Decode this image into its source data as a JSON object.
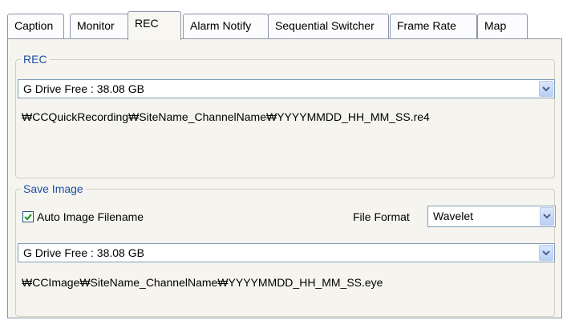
{
  "tabs": [
    {
      "label": "Caption",
      "active": false
    },
    {
      "label": "Monitor",
      "active": false
    },
    {
      "label": "REC",
      "active": true
    },
    {
      "label": "Alarm Notify",
      "active": false
    },
    {
      "label": "Sequential Switcher",
      "active": false
    },
    {
      "label": "Frame Rate",
      "active": false
    },
    {
      "label": "Map",
      "active": false
    }
  ],
  "rec": {
    "title": "REC",
    "drive": "G Drive  Free : 38.08 GB",
    "path": "₩CCQuickRecording₩SiteName_ChannelName₩YYYYMMDD_HH_MM_SS.re4"
  },
  "save_image": {
    "title": "Save Image",
    "auto_filename_label": "Auto Image Filename",
    "auto_filename_checked": true,
    "file_format_label": "File Format",
    "file_format": "Wavelet",
    "drive": "G Drive  Free : 38.08 GB",
    "path": "₩CCImage₩SiteName_ChannelName₩YYYYMMDD_HH_MM_SS.eye"
  },
  "icons": {
    "dropdown": "chevron-down-icon",
    "checkmark": "checkmark-icon"
  },
  "colors": {
    "group_title": "#1e4ea4",
    "panel_bg": "#f5f4ee",
    "checkmark": "#21a121"
  }
}
